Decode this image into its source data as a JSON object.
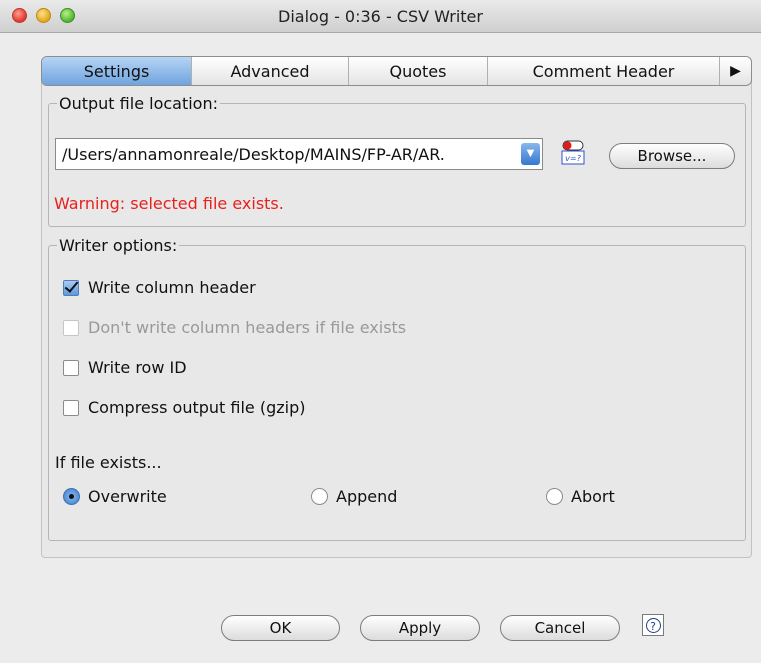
{
  "window": {
    "title": "Dialog - 0:36 - CSV Writer"
  },
  "tabs": [
    {
      "label": "Settings",
      "active": true
    },
    {
      "label": "Advanced"
    },
    {
      "label": "Quotes"
    },
    {
      "label": "Comment Header"
    }
  ],
  "tab_overflow_icon": "triangle-right-icon",
  "output": {
    "legend": "Output file location:",
    "path": "/Users/annamonreale/Desktop/MAINS/FP-AR/AR.",
    "variable_icon": "flow-variable-icon",
    "browse_label": "Browse...",
    "warning": "Warning: selected file exists."
  },
  "writer": {
    "legend": "Writer options:",
    "options": [
      {
        "label": "Write column header",
        "checked": true,
        "enabled": true
      },
      {
        "label": "Don't write column headers if file exists",
        "checked": false,
        "enabled": false
      },
      {
        "label": "Write row ID",
        "checked": false,
        "enabled": true
      },
      {
        "label": "Compress output file (gzip)",
        "checked": false,
        "enabled": true
      }
    ],
    "if_exists_label": "If file exists...",
    "radios": [
      {
        "label": "Overwrite",
        "selected": true
      },
      {
        "label": "Append",
        "selected": false
      },
      {
        "label": "Abort",
        "selected": false
      }
    ]
  },
  "buttons": {
    "ok": "OK",
    "apply": "Apply",
    "cancel": "Cancel"
  },
  "help": {
    "glyph": "?",
    "icon": "help-icon"
  },
  "colors": {
    "warning": "#e8211d",
    "accent": "#5e99dc"
  }
}
